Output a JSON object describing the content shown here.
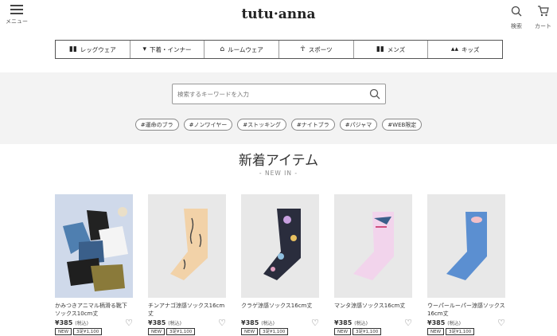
{
  "header": {
    "menu_label": "メニュー",
    "logo": "tutu·anna",
    "search_label": "検索",
    "cart_label": "カート"
  },
  "nav": {
    "items": [
      {
        "label": "レッグウェア",
        "icon": "legwear-icon"
      },
      {
        "label": "下着・インナー",
        "icon": "underwear-icon"
      },
      {
        "label": "ルームウェア",
        "icon": "roomwear-icon"
      },
      {
        "label": "スポーツ",
        "icon": "sports-icon"
      },
      {
        "label": "メンズ",
        "icon": "mens-icon"
      },
      {
        "label": "キッズ",
        "icon": "kids-icon"
      }
    ]
  },
  "search": {
    "placeholder": "検索するキーワードを入力",
    "tags": [
      "#運命のブラ",
      "#ノンワイヤー",
      "#ストッキング",
      "#ナイトブラ",
      "#パジャマ",
      "#WEB限定"
    ]
  },
  "section": {
    "title": "新着アイテム",
    "subtitle": "- NEW IN -"
  },
  "products": [
    {
      "name": "かみつきアニマル柄滑る靴下 ソックス10cm丈",
      "price": "¥385",
      "tax": "(税込)",
      "badges": [
        "NEW",
        "3足¥1,100"
      ],
      "sock_color": "#6b8ba8",
      "bg": "#cfd9ea"
    },
    {
      "name": "チンアナゴ涼感ソックス16cm丈",
      "price": "¥385",
      "tax": "(税込)",
      "badges": [
        "NEW",
        "3足¥1,100"
      ],
      "sock_color": "#f2d2a8",
      "bg": "#e8e8e8"
    },
    {
      "name": "クラゲ涼感ソックス16cm丈",
      "price": "¥385",
      "tax": "(税込)",
      "badges": [
        "NEW",
        "3足¥1,100"
      ],
      "sock_color": "#2a2d3d",
      "bg": "#e8e8e8"
    },
    {
      "name": "マンタ涼感ソックス16cm丈",
      "price": "¥385",
      "tax": "(税込)",
      "badges": [
        "NEW",
        "3足¥1,100"
      ],
      "sock_color": "#f2d4ec",
      "bg": "#e8e8e8"
    },
    {
      "name": "ウーパールーパー涼感ソックス16cm丈",
      "price": "¥385",
      "tax": "(税込)",
      "badges": [
        "NEW",
        "3足¥1,100"
      ],
      "sock_color": "#5b8fd1",
      "bg": "#e8e8e8"
    }
  ]
}
